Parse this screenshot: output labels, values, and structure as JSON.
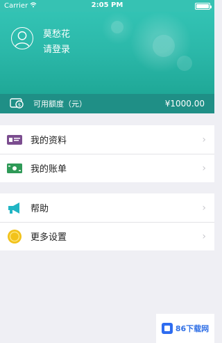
{
  "status_bar": {
    "carrier": "Carrier",
    "time": "2:05 PM"
  },
  "profile": {
    "name": "莫愁花",
    "login_text": "请登录"
  },
  "credit": {
    "label": "可用额度（元）",
    "amount": "¥1000.00"
  },
  "menu_groups": [
    {
      "items": [
        {
          "label": "我的资料",
          "icon": "profile-card-icon"
        },
        {
          "label": "我的账单",
          "icon": "bill-money-icon"
        }
      ]
    },
    {
      "items": [
        {
          "label": "帮助",
          "icon": "megaphone-icon"
        },
        {
          "label": "更多设置",
          "icon": "coin-icon"
        }
      ]
    }
  ],
  "watermark": {
    "text": "86下载网"
  },
  "colors": {
    "header_teal": "#2bb8a9",
    "credit_bar": "#1f8f86"
  }
}
